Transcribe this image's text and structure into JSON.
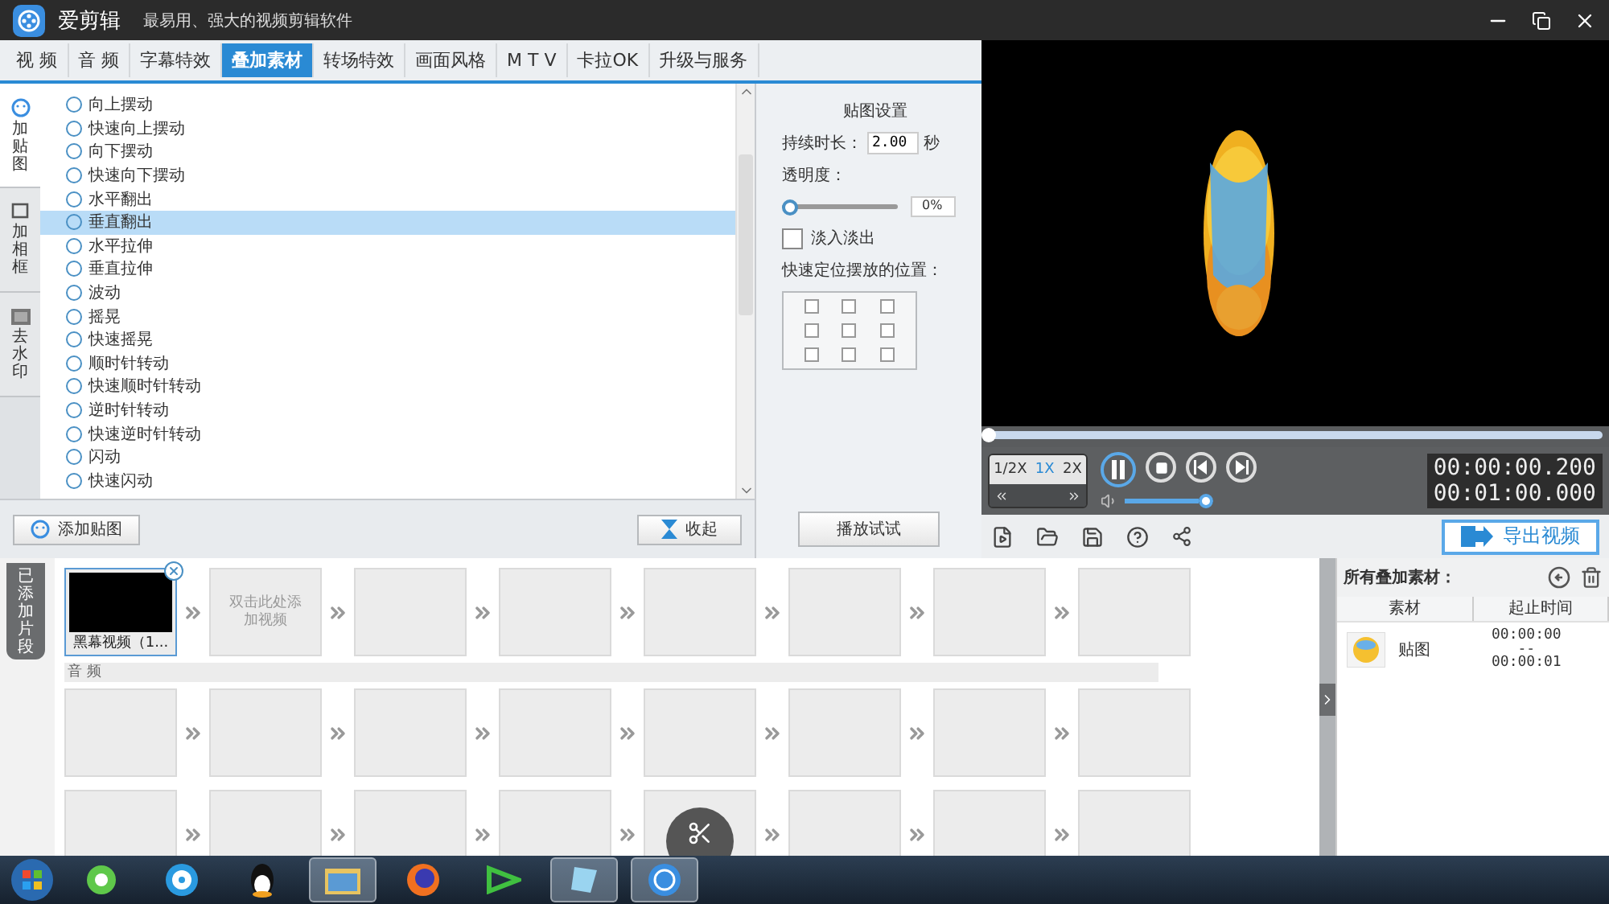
{
  "app": {
    "name": "爱剪辑",
    "tagline": "最易用、强大的视频剪辑软件"
  },
  "tabs": [
    {
      "label": "视 频",
      "selected": false
    },
    {
      "label": "音 频",
      "selected": false
    },
    {
      "label": "字幕特效",
      "selected": false
    },
    {
      "label": "叠加素材",
      "selected": true
    },
    {
      "label": "转场特效",
      "selected": false
    },
    {
      "label": "画面风格",
      "selected": false
    },
    {
      "label": "M T V",
      "selected": false
    },
    {
      "label": "卡拉OK",
      "selected": false
    },
    {
      "label": "升级与服务",
      "selected": false
    }
  ],
  "side_tabs": [
    {
      "label": "加贴图",
      "kind": "sticker",
      "selected": true
    },
    {
      "label": "加相框",
      "kind": "frame",
      "selected": false
    },
    {
      "label": "去水印",
      "kind": "watermark",
      "selected": false
    }
  ],
  "effects": [
    {
      "label": "向上摆动",
      "selected": false
    },
    {
      "label": "快速向上摆动",
      "selected": false
    },
    {
      "label": "向下摆动",
      "selected": false
    },
    {
      "label": "快速向下摆动",
      "selected": false
    },
    {
      "label": "水平翻出",
      "selected": false
    },
    {
      "label": "垂直翻出",
      "selected": true
    },
    {
      "label": "水平拉伸",
      "selected": false
    },
    {
      "label": "垂直拉伸",
      "selected": false
    },
    {
      "label": "波动",
      "selected": false
    },
    {
      "label": "摇晃",
      "selected": false
    },
    {
      "label": "快速摇晃",
      "selected": false
    },
    {
      "label": "顺时针转动",
      "selected": false
    },
    {
      "label": "快速顺时针转动",
      "selected": false
    },
    {
      "label": "逆时针转动",
      "selected": false
    },
    {
      "label": "快速逆时针转动",
      "selected": false
    },
    {
      "label": "闪动",
      "selected": false
    },
    {
      "label": "快速闪动",
      "selected": false
    }
  ],
  "list_buttons": {
    "add": "添加贴图",
    "collapse": "收起"
  },
  "settings": {
    "title": "贴图设置",
    "duration_label": "持续时长：",
    "duration": "2.00",
    "duration_unit": "秒",
    "opacity_label": "透明度：",
    "opacity": {
      "level": 0
    },
    "opacity_value": "0%",
    "fade": {
      "label": "淡入淡出",
      "checked": false
    },
    "position_label": "快速定位摆放的位置：",
    "positions": [
      {
        "checked": false
      },
      {
        "checked": false
      },
      {
        "checked": false
      },
      {
        "checked": false
      },
      {
        "checked": false
      },
      {
        "checked": false
      },
      {
        "checked": false
      },
      {
        "checked": false
      },
      {
        "checked": false
      }
    ],
    "play_button": "播放试试"
  },
  "player": {
    "progress": {
      "level": 0
    },
    "speeds": [
      {
        "label": "1/2X",
        "selected": false
      },
      {
        "label": "1X",
        "selected": true
      },
      {
        "label": "2X",
        "selected": false
      }
    ],
    "playing": true,
    "volume": {
      "level": 1
    },
    "current_time": "00:00:00.200",
    "total_time": "00:01:00.000",
    "export_button": "导出视频"
  },
  "timeline": {
    "side_label": "已添加片段",
    "video_clips": [
      {
        "kind": "clip",
        "label": "黑幕视频（1..."
      },
      {
        "kind": "add",
        "label": "双击此处添加视频"
      },
      {
        "kind": "empty"
      },
      {
        "kind": "empty"
      },
      {
        "kind": "empty"
      },
      {
        "kind": "empty"
      },
      {
        "kind": "empty"
      },
      {
        "kind": "empty"
      }
    ],
    "audio_label": "音 频",
    "audio_clips": [
      {
        "kind": "empty"
      },
      {
        "kind": "empty"
      },
      {
        "kind": "empty"
      },
      {
        "kind": "empty"
      },
      {
        "kind": "empty"
      },
      {
        "kind": "empty"
      },
      {
        "kind": "empty"
      },
      {
        "kind": "empty"
      }
    ],
    "extra_clips": [
      {
        "kind": "empty"
      },
      {
        "kind": "empty"
      },
      {
        "kind": "empty"
      },
      {
        "kind": "empty"
      },
      {
        "kind": "scissors"
      },
      {
        "kind": "empty"
      },
      {
        "kind": "empty"
      },
      {
        "kind": "empty"
      }
    ]
  },
  "overlay_panel": {
    "title": "所有叠加素材：",
    "columns": [
      "素材",
      "起止时间"
    ],
    "rows": [
      {
        "name": "贴图",
        "start": "00:00:00",
        "separator": "--",
        "end": "00:00:01"
      }
    ]
  },
  "taskbar": [
    {
      "kind": "browser",
      "open": false
    },
    {
      "kind": "reel",
      "open": false
    },
    {
      "kind": "bird",
      "open": false
    },
    {
      "kind": "folder",
      "open": true
    },
    {
      "kind": "globe",
      "open": false
    },
    {
      "kind": "media",
      "open": false
    },
    {
      "kind": "paper",
      "open": true
    },
    {
      "kind": "app",
      "open": true
    }
  ]
}
